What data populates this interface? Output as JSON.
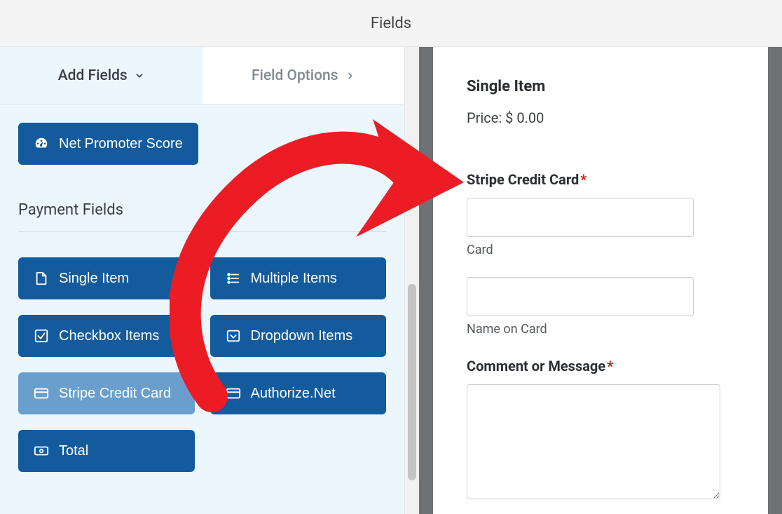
{
  "header": {
    "title": "Fields"
  },
  "tabs": {
    "add_fields": "Add Fields",
    "field_options": "Field Options"
  },
  "top_button": "Net Promoter Score",
  "section_title": "Payment Fields",
  "payment_buttons": {
    "single_item": "Single Item",
    "multiple_items": "Multiple Items",
    "checkbox_items": "Checkbox Items",
    "dropdown_items": "Dropdown Items",
    "stripe": "Stripe Credit Card",
    "authorize": "Authorize.Net",
    "total": "Total"
  },
  "preview": {
    "single_item_heading": "Single Item",
    "price_line": "Price: $ 0.00",
    "stripe_label": "Stripe Credit Card",
    "card_sublabel": "Card",
    "name_sublabel": "Name on Card",
    "comment_label": "Comment or Message"
  }
}
